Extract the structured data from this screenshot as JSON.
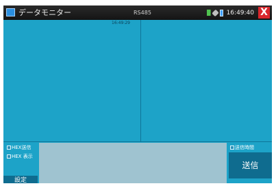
{
  "titlebar": {
    "app_title": "データモニター",
    "center_title": "RS485",
    "clock": "16:49:40",
    "close_label": "X",
    "icons": [
      "app-icon",
      "signal-icon",
      "plug-icon",
      "battery-icon",
      "close-icon"
    ]
  },
  "monitor": {
    "time_label": "16:49:29"
  },
  "controls": {
    "hex_send_label": "HEX送信",
    "hex_display_label": "HEX 表示",
    "send_time_label": "送信時間",
    "settings_label": "設定",
    "send_label": "送信"
  },
  "colors": {
    "background": "#1da3c8",
    "titlebar": "#1a1a1a",
    "input_area": "#9fc3d0",
    "buttons": "#0f6c8f",
    "close": "#d9262c"
  }
}
